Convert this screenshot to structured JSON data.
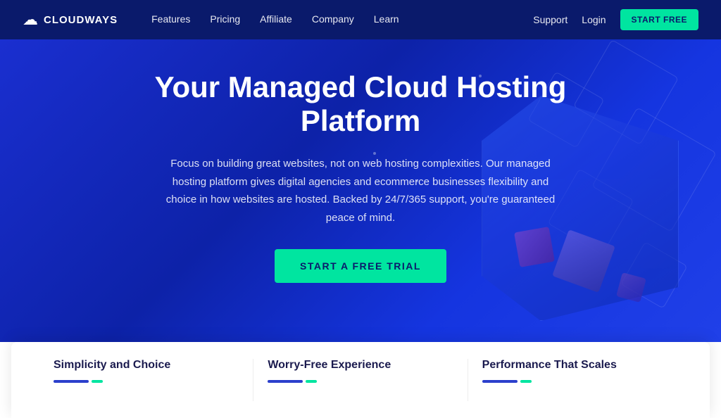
{
  "nav": {
    "logo_text": "CLOUDWAYS",
    "links": [
      {
        "label": "Features",
        "name": "nav-features"
      },
      {
        "label": "Pricing",
        "name": "nav-pricing"
      },
      {
        "label": "Affiliate",
        "name": "nav-affiliate"
      },
      {
        "label": "Company",
        "name": "nav-company"
      },
      {
        "label": "Learn",
        "name": "nav-learn"
      }
    ],
    "support_label": "Support",
    "login_label": "Login",
    "start_btn_label": "START FREE"
  },
  "hero": {
    "title": "Your Managed Cloud Hosting Platform",
    "description": "Focus on building great websites, not on web hosting complexities. Our managed hosting platform gives digital agencies and ecommerce businesses flexibility and choice in how websites are hosted. Backed by 24/7/365 support, you're guaranteed peace of mind.",
    "cta_label": "START A FREE TRIAL"
  },
  "features": [
    {
      "title": "Simplicity and Choice"
    },
    {
      "title": "Worry-Free Experience"
    },
    {
      "title": "Performance That Scales"
    }
  ]
}
